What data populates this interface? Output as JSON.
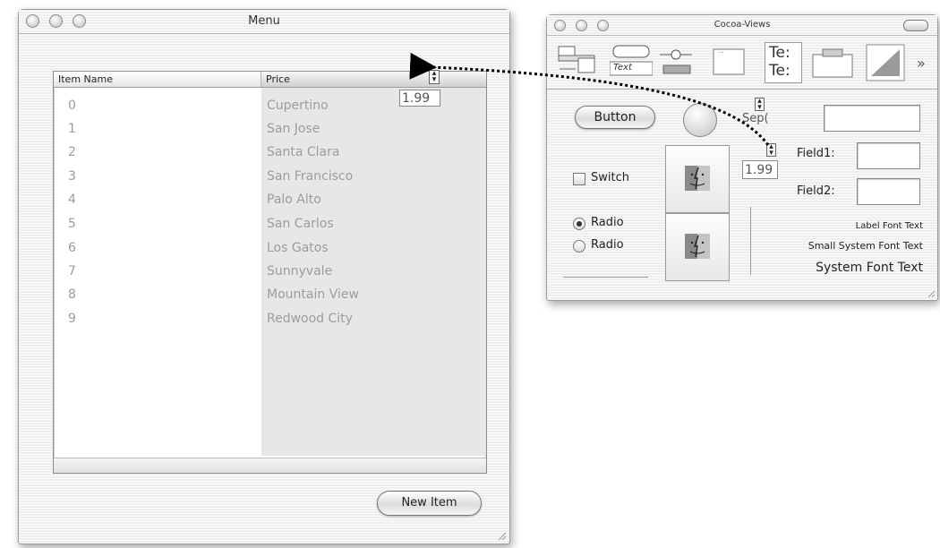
{
  "menu_window": {
    "title": "Menu",
    "columns": [
      "Item Name",
      "Price"
    ],
    "rows": [
      {
        "name": "0",
        "price": "Cupertino"
      },
      {
        "name": "1",
        "price": "San Jose"
      },
      {
        "name": "2",
        "price": "Santa Clara"
      },
      {
        "name": "3",
        "price": "San Francisco"
      },
      {
        "name": "4",
        "price": "Palo Alto"
      },
      {
        "name": "5",
        "price": "San Carlos"
      },
      {
        "name": "6",
        "price": "Los Gatos"
      },
      {
        "name": "7",
        "price": "Sunnyvale"
      },
      {
        "name": "8",
        "price": "Mountain View"
      },
      {
        "name": "9",
        "price": "Redwood City"
      }
    ],
    "formatter_value": "1.99",
    "new_item_label": "New Item"
  },
  "palette_window": {
    "title": "Cocoa-Views",
    "tool_text_1": "Text",
    "tool_text_2": "Te:",
    "tool_text_3": "Te:",
    "chevron": "»",
    "button_label": "Button",
    "separator_text": "Sep(",
    "switch_label": "Switch",
    "radio_1": "Radio",
    "radio_2": "Radio",
    "formatter_value": "1.99",
    "field1_label": "Field1:",
    "field2_label": "Field2:",
    "label_font_text": "Label Font Text",
    "small_system_font_text": "Small System Font Text",
    "system_font_text": "System Font Text"
  },
  "colors": {
    "window_bg": "#eeeeee",
    "price_column_bg": "#e7e7e7",
    "cell_text": "#9c9c9c"
  },
  "icons": [
    "close-icon",
    "minimize-icon",
    "zoom-icon",
    "stepper-icon",
    "toolbar-toggle-icon",
    "finder-icon",
    "drag-arrow-icon"
  ]
}
